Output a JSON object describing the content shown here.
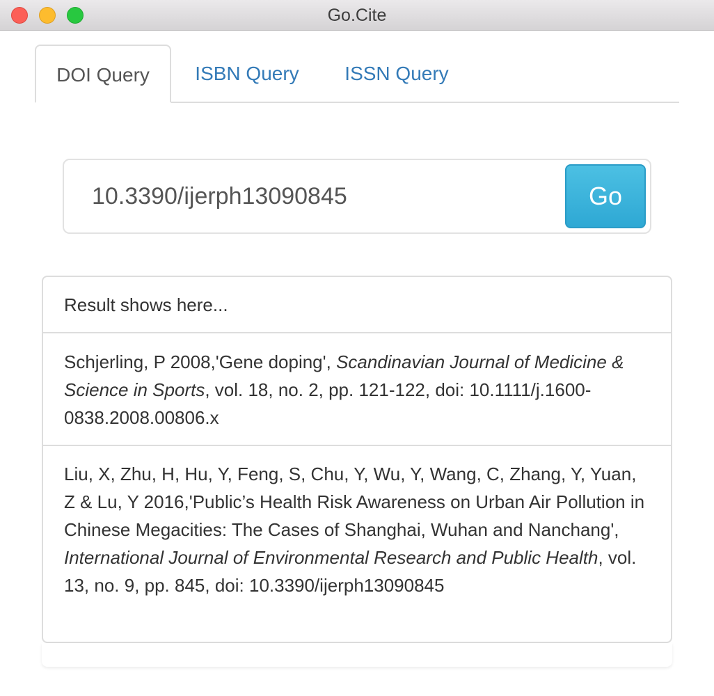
{
  "window": {
    "title": "Go.Cite"
  },
  "tabs": [
    {
      "label": "DOI Query",
      "active": true
    },
    {
      "label": "ISBN Query",
      "active": false
    },
    {
      "label": "ISSN Query",
      "active": false
    }
  ],
  "search": {
    "value": "10.3390/ijerph13090845",
    "button_label": "Go"
  },
  "results": {
    "heading": "Result shows here...",
    "items": [
      {
        "prefix": "Schjerling, P 2008,'Gene doping', ",
        "journal": "Scandinavian Journal of Medicine & Science in Sports",
        "suffix": ", vol. 18, no. 2, pp. 121-122, doi: 10.1111/j.1600-0838.2008.00806.x"
      },
      {
        "prefix": "Liu, X, Zhu, H, Hu, Y, Feng, S, Chu, Y, Wu, Y, Wang, C, Zhang, Y, Yuan, Z & Lu, Y 2016,'Public’s Health Risk Awareness on Urban Air Pollution in Chinese Megacities: The Cases of Shanghai, Wuhan and Nanchang', ",
        "journal": "International Journal of Environmental Research and Public Health",
        "suffix": ", vol. 13, no. 9, pp. 845, doi: 10.3390/ijerph13090845"
      }
    ]
  },
  "colors": {
    "link": "#337ab7",
    "button": "#31b0d5",
    "border": "#dddddd"
  }
}
